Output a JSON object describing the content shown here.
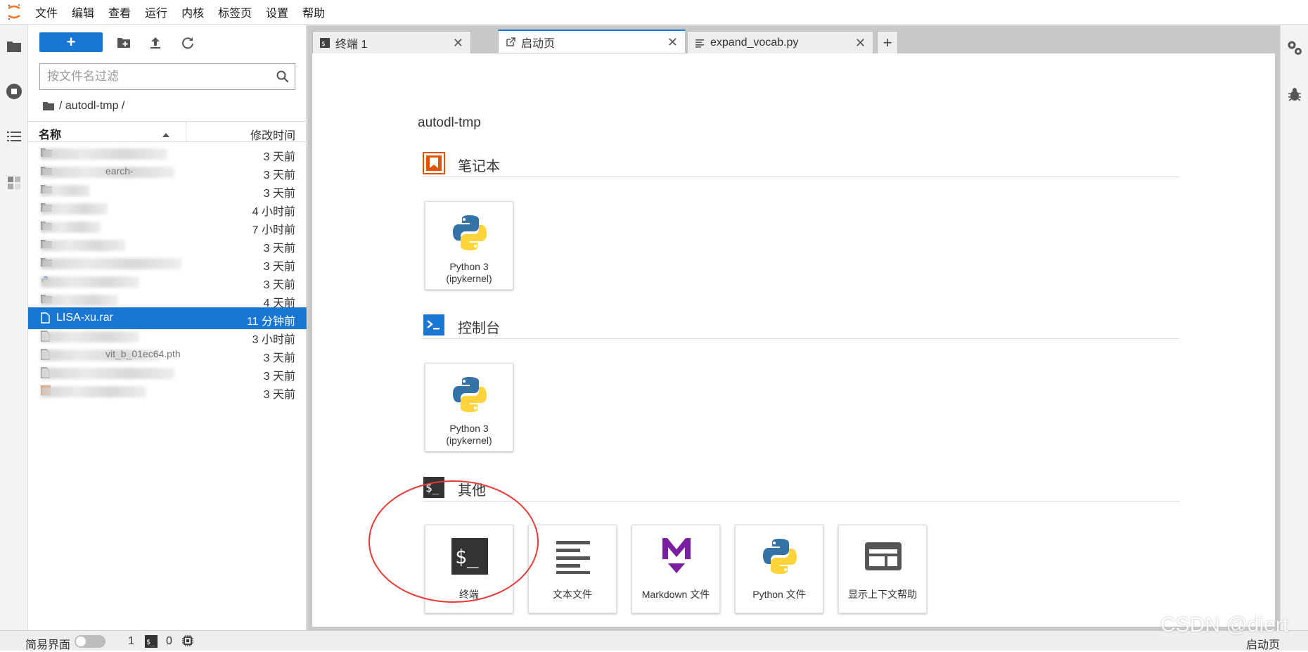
{
  "menubar": {
    "items": [
      "文件",
      "编辑",
      "查看",
      "运行",
      "内核",
      "标签页",
      "设置",
      "帮助"
    ]
  },
  "filebrowser": {
    "new_label": "+",
    "filter_placeholder": "按文件名过滤",
    "breadcrumb": "/ autodl-tmp /",
    "header_name": "名称",
    "header_time": "修改时间",
    "rows": [
      {
        "name": "",
        "time": "3 天前",
        "icon": "folder",
        "obscured": true
      },
      {
        "name": "earch-",
        "time": "3 天前",
        "icon": "folder",
        "obscured": true
      },
      {
        "name": "",
        "time": "3 天前",
        "icon": "folder",
        "obscured": true
      },
      {
        "name": "",
        "time": "4 小时前",
        "icon": "folder",
        "obscured": true
      },
      {
        "name": "",
        "time": "7 小时前",
        "icon": "folder",
        "obscured": true
      },
      {
        "name": "",
        "time": "3 天前",
        "icon": "folder",
        "obscured": true
      },
      {
        "name": "",
        "time": "3 天前",
        "icon": "folder",
        "obscured": true
      },
      {
        "name": "",
        "time": "3 天前",
        "icon": "python-file",
        "obscured": true
      },
      {
        "name": "",
        "time": "4 天前",
        "icon": "folder",
        "obscured": true
      },
      {
        "name": "LISA-xu.rar",
        "time": "11 分钟前",
        "icon": "file",
        "obscured": false,
        "selected": true
      },
      {
        "name": "",
        "time": "3 小时前",
        "icon": "file",
        "obscured": true
      },
      {
        "name": "vit_b_01ec64.pth",
        "time": "3 天前",
        "icon": "file",
        "obscured": true
      },
      {
        "name": "",
        "time": "3 天前",
        "icon": "file",
        "obscured": true
      },
      {
        "name": "",
        "time": "3 天前",
        "icon": "image-file",
        "obscured": true
      }
    ]
  },
  "tabs": [
    {
      "label": "终端 1",
      "icon": "terminal-icon"
    },
    {
      "label": "启动页",
      "icon": "launcher-icon",
      "active": true
    },
    {
      "label": "expand_vocab.py",
      "icon": "text-file-icon"
    }
  ],
  "tab_close": "✕",
  "tab_add": "+",
  "launcher": {
    "cwd": "autodl-tmp",
    "sections": [
      {
        "title": "笔记本",
        "icon": "notebook-icon",
        "cards": [
          {
            "label": "Python 3 (ipykernel)",
            "icon": "python-logo-icon"
          }
        ]
      },
      {
        "title": "控制台",
        "icon": "console-icon",
        "cards": [
          {
            "label": "Python 3 (ipykernel)",
            "icon": "python-logo-icon"
          }
        ]
      },
      {
        "title": "其他",
        "icon": "other-terminal-icon",
        "cards": [
          {
            "label": "终端",
            "icon": "terminal-icon"
          },
          {
            "label": "文本文件",
            "icon": "text-file-icon"
          },
          {
            "label": "Markdown 文件",
            "icon": "markdown-icon"
          },
          {
            "label": "Python 文件",
            "icon": "python-logo-icon"
          },
          {
            "label": "显示上下文帮助",
            "icon": "context-help-icon"
          }
        ]
      }
    ]
  },
  "statusbar": {
    "simple_mode_label": "简易界面",
    "kernels_count": "1",
    "terminals_count": "0",
    "right_label": "启动页"
  },
  "watermark": "CSDN @diert",
  "colors": {
    "accent": "#1976d2",
    "notebook_orange": "#e65100",
    "markdown_purple": "#7b1fa2",
    "annotation_red": "#e53935"
  }
}
